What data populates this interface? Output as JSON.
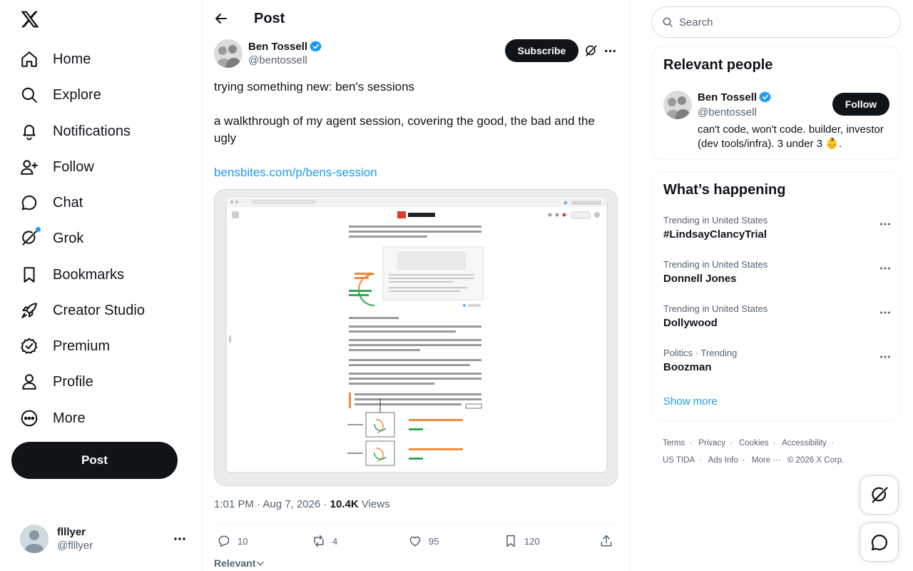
{
  "nav": {
    "logo_icon": "x-logo-icon",
    "items": [
      {
        "label": "Home",
        "icon": "home-icon"
      },
      {
        "label": "Explore",
        "icon": "search-icon"
      },
      {
        "label": "Notifications",
        "icon": "bell-icon"
      },
      {
        "label": "Follow",
        "icon": "person-add-icon"
      },
      {
        "label": "Chat",
        "icon": "chat-icon"
      },
      {
        "label": "Grok",
        "icon": "grok-icon"
      },
      {
        "label": "Bookmarks",
        "icon": "bookmark-icon"
      },
      {
        "label": "Creator Studio",
        "icon": "rocket-icon"
      },
      {
        "label": "Premium",
        "icon": "verified-badge-icon"
      },
      {
        "label": "Profile",
        "icon": "person-icon"
      },
      {
        "label": "More",
        "icon": "more-circle-icon"
      }
    ],
    "post_label": "Post"
  },
  "account": {
    "name": "flllyer",
    "handle": "@flllyer"
  },
  "main": {
    "title": "Post",
    "author": {
      "name": "Ben Tossell",
      "handle": "@bentossell"
    },
    "subscribe_label": "Subscribe",
    "text_line1": "trying something new: ben's sessions",
    "text_line2": "a walkthrough of my agent session, covering the good, the bad and the ugly",
    "link": "bensbites.com/p/bens-session",
    "time": "1:01 PM · Aug 7, 2026",
    "views_count": "10.4K",
    "views_label": "Views",
    "stats": {
      "replies": "10",
      "reposts": "4",
      "likes": "95",
      "bookmarks": "120"
    },
    "sort_label": "Relevant"
  },
  "right": {
    "search_placeholder": "Search",
    "relevant_title": "Relevant people",
    "person": {
      "name": "Ben Tossell",
      "handle": "@bentossell",
      "follow_label": "Follow",
      "bio": "can't code, won't code. builder, investor (dev tools/infra). 3 under 3 👶."
    },
    "happening_title": "What’s happening",
    "trends": [
      {
        "context": "Trending in United States",
        "name": "#LindsayClancyTrial"
      },
      {
        "context": "Trending in United States",
        "name": "Donnell Jones"
      },
      {
        "context": "Trending in United States",
        "name": "Dollywood"
      },
      {
        "context": "Politics · Trending",
        "name": "Boozman"
      }
    ],
    "show_more": "Show more",
    "footer": [
      "Terms",
      "Privacy",
      "Cookies",
      "Accessibility",
      "US TIDA",
      "Ads Info",
      "More ···",
      "© 2026 X Corp."
    ]
  },
  "colors": {
    "accent": "#1d9bf0",
    "text": "#0f1419",
    "muted": "#536471",
    "border": "#eff3f4"
  }
}
